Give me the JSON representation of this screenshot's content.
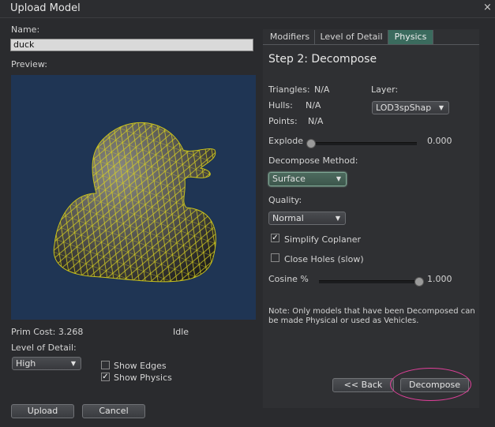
{
  "window": {
    "title": "Upload Model",
    "close_glyph": "×"
  },
  "left": {
    "name_label": "Name:",
    "name_value": "duck",
    "preview_label": "Preview:",
    "prim_cost": "Prim Cost: 3.268",
    "status": "Idle",
    "lod_label": "Level of Detail:",
    "lod_value": "High",
    "show_edges": {
      "label": "Show Edges",
      "checked": false
    },
    "show_physics": {
      "label": "Show Physics",
      "checked": true
    },
    "upload_label": "Upload",
    "cancel_label": "Cancel"
  },
  "right": {
    "tabs": [
      {
        "label": "Modifiers",
        "active": false
      },
      {
        "label": "Level of Detail",
        "active": false
      },
      {
        "label": "Physics",
        "active": true
      }
    ],
    "step_title": "Step 2: Decompose",
    "triangles_label": "Triangles:",
    "triangles_value": "N/A",
    "hulls_label": "Hulls:",
    "hulls_value": "N/A",
    "points_label": "Points:",
    "points_value": "N/A",
    "layer_label": "Layer:",
    "layer_value": "LOD3spShap",
    "explode_label": "Explode",
    "explode_value": "0.000",
    "explode_fraction": 0.0,
    "decompose_method_label": "Decompose Method:",
    "decompose_method_value": "Surface",
    "quality_label": "Quality:",
    "quality_value": "Normal",
    "simplify_coplanar": {
      "label": "Simplify Coplaner",
      "checked": true
    },
    "close_holes": {
      "label": "Close Holes (slow)",
      "checked": false
    },
    "cosine_label": "Cosine %",
    "cosine_value": "1.000",
    "cosine_fraction": 1.0,
    "note": "Note: Only models that have been Decomposed can be made Physical or used as Vehicles.",
    "back_label": "<< Back",
    "decompose_label": "Decompose"
  },
  "colors": {
    "accent_tab": "#3b6b5e",
    "highlight_circle": "#e0409a",
    "preview_bg": "#1f3554",
    "wireframe": "#d8d020"
  },
  "icons": {
    "dropdown": "chevron-down-icon",
    "check": "checkmark-icon",
    "close": "close-icon"
  }
}
